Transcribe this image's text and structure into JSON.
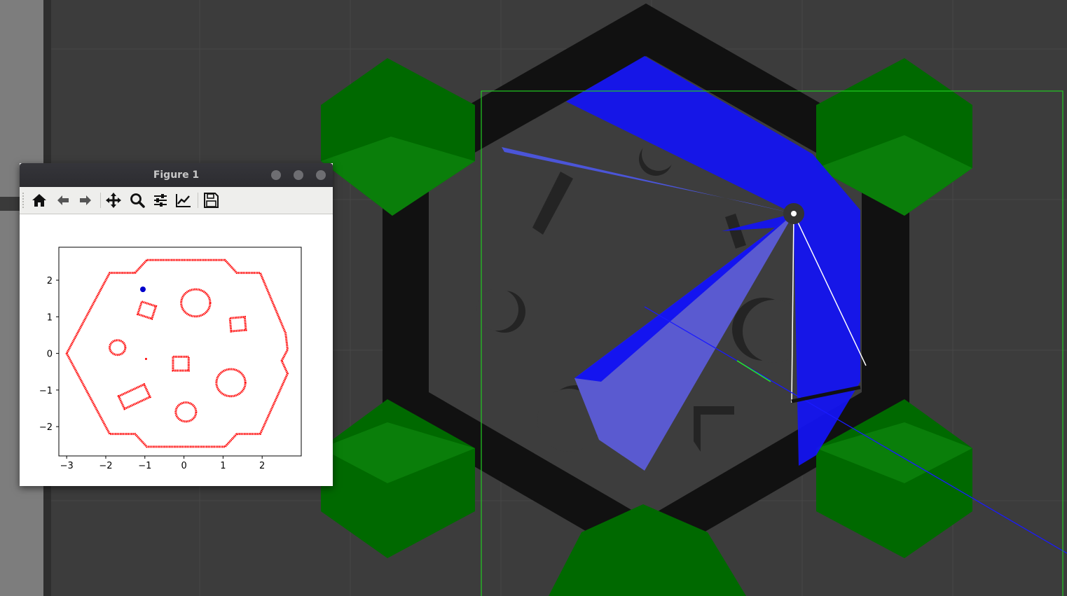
{
  "figure_window": {
    "title": "Figure 1",
    "toolbar": {
      "home": "home-icon",
      "back": "arrow-left-icon",
      "forward": "arrow-right-icon",
      "pan": "move-icon",
      "zoom": "zoom-icon",
      "configure": "sliders-icon",
      "edit_axes": "line-chart-icon",
      "save": "save-icon"
    }
  },
  "colors": {
    "background": "#3c3c3c",
    "wall": "#111111",
    "obstacle_pad": "#006b00",
    "laser": "#1414f0",
    "bounds": "#22cc22",
    "map_points": "#ff0000",
    "robot_marker": "#0000cc"
  },
  "chart_data": {
    "type": "scatter",
    "xlim": [
      -3.2,
      3.0
    ],
    "ylim": [
      -2.8,
      2.9
    ],
    "xticks": [
      -3,
      -2,
      -1,
      0,
      1,
      2
    ],
    "yticks": [
      -2,
      -1,
      0,
      1,
      2
    ],
    "xtick_labels": [
      "−3",
      "−2",
      "−1",
      "0",
      "1",
      "2"
    ],
    "ytick_labels": [
      "−2",
      "−1",
      "0",
      "1",
      "2"
    ],
    "grid": false,
    "series": [
      {
        "kind": "polygon",
        "color": "#ff0000",
        "points": [
          [
            -0.95,
            2.55
          ],
          [
            1.05,
            2.55
          ],
          [
            1.35,
            2.2
          ],
          [
            1.95,
            2.2
          ],
          [
            2.6,
            0.55
          ],
          [
            2.65,
            0.1
          ],
          [
            2.5,
            -0.2
          ],
          [
            2.65,
            -0.55
          ],
          [
            1.95,
            -2.2
          ],
          [
            1.35,
            -2.2
          ],
          [
            1.05,
            -2.55
          ],
          [
            -0.95,
            -2.55
          ],
          [
            -1.25,
            -2.2
          ],
          [
            -1.9,
            -2.2
          ],
          [
            -3.0,
            0
          ],
          [
            -1.9,
            2.2
          ],
          [
            -1.25,
            2.2
          ]
        ]
      },
      {
        "kind": "circle",
        "color": "#ff0000",
        "cx": 0.3,
        "cy": 1.38,
        "r": 0.37
      },
      {
        "kind": "circle",
        "color": "#ff0000",
        "cx": -1.7,
        "cy": 0.16,
        "r": 0.2
      },
      {
        "kind": "circle",
        "color": "#ff0000",
        "cx": 1.2,
        "cy": -0.8,
        "r": 0.37
      },
      {
        "kind": "circle",
        "color": "#ff0000",
        "cx": 0.05,
        "cy": -1.6,
        "r": 0.26
      },
      {
        "kind": "rect",
        "color": "#ff0000",
        "cx": -0.95,
        "cy": 1.18,
        "w": 0.38,
        "h": 0.36,
        "angle": 18
      },
      {
        "kind": "rect",
        "color": "#ff0000",
        "cx": 1.38,
        "cy": 0.8,
        "w": 0.38,
        "h": 0.36,
        "angle": -5
      },
      {
        "kind": "rect",
        "color": "#ff0000",
        "cx": -0.08,
        "cy": -0.28,
        "w": 0.4,
        "h": 0.38,
        "angle": 0
      },
      {
        "kind": "rect",
        "color": "#ff0000",
        "cx": -1.27,
        "cy": -1.18,
        "w": 0.72,
        "h": 0.38,
        "angle": -25
      },
      {
        "kind": "point",
        "color": "#ff0000",
        "x": -0.97,
        "y": -0.15,
        "size": 1.5
      },
      {
        "kind": "point",
        "color": "#0000cc",
        "x": -1.05,
        "y": 1.75,
        "size": 4
      }
    ]
  }
}
